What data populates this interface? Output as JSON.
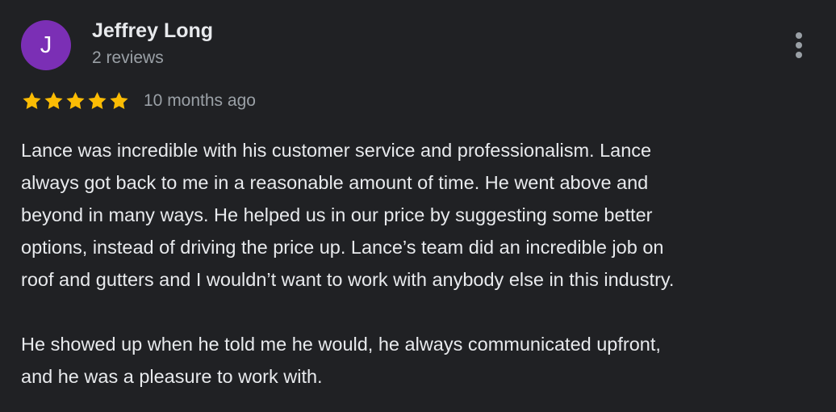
{
  "review": {
    "author": {
      "initial": "J",
      "name": "Jeffrey Long",
      "reviews_count": "2 reviews",
      "avatar_color": "#7b2fb5"
    },
    "more_options_icon": "more-vert-icon",
    "rating": {
      "stars": 5,
      "max_stars": 5,
      "star_color": "#fbbc04",
      "star_icon": "star-icon"
    },
    "date": "10 months ago",
    "paragraphs": [
      "Lance was incredible with his customer service and professionalism. Lance\nalways got back to me in a reasonable amount of time. He went above and\nbeyond in many ways. He helped us in our price by suggesting some better\noptions, instead of driving the price up. Lance’s team did an incredible job on\nroof and gutters and I wouldn’t want to work with anybody else in this industry.",
      "He showed up when he told me he would, he always communicated upfront,\nand he was a pleasure to work with."
    ]
  }
}
